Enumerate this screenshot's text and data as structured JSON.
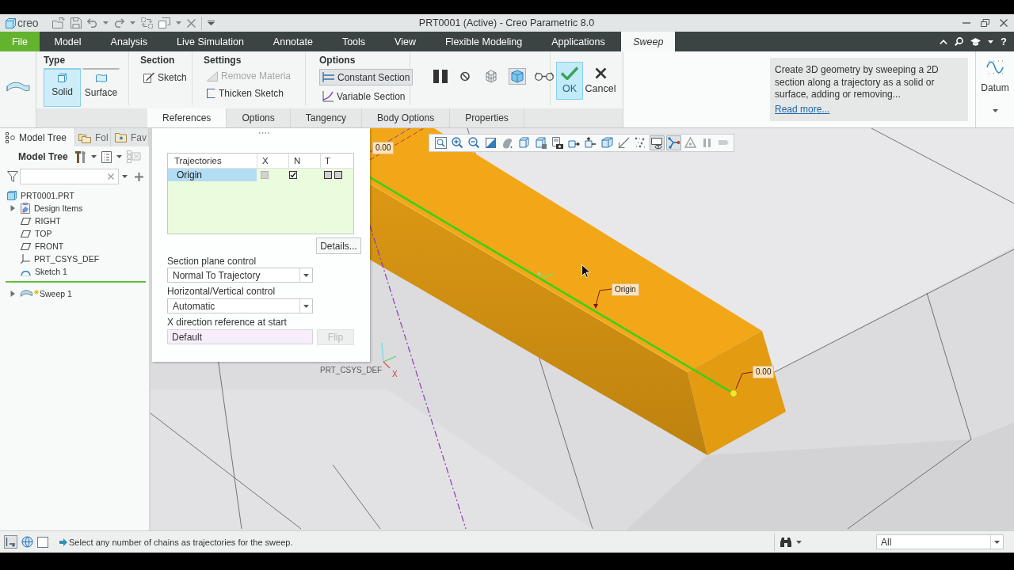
{
  "window": {
    "logo": "creo",
    "title": "PRT0001 (Active) - Creo Parametric 8.0"
  },
  "menu_tabs": [
    {
      "label": "File",
      "kind": "file",
      "selected": false
    },
    {
      "label": "Model",
      "kind": "tab",
      "selected": false
    },
    {
      "label": "Analysis",
      "kind": "tab",
      "selected": false
    },
    {
      "label": "Live Simulation",
      "kind": "tab",
      "selected": false
    },
    {
      "label": "Annotate",
      "kind": "tab",
      "selected": false
    },
    {
      "label": "Tools",
      "kind": "tab",
      "selected": false
    },
    {
      "label": "View",
      "kind": "tab",
      "selected": false
    },
    {
      "label": "Flexible Modeling",
      "kind": "tab",
      "selected": false
    },
    {
      "label": "Applications",
      "kind": "tab",
      "selected": false
    },
    {
      "label": "Sweep",
      "kind": "tab",
      "selected": true
    }
  ],
  "help_button": "?",
  "ribbon": {
    "type_group": {
      "title": "Type",
      "options": [
        {
          "label": "Solid",
          "kind": "solid",
          "selected": true
        },
        {
          "label": "Surface",
          "kind": "surface",
          "selected": false
        }
      ]
    },
    "section_group": {
      "title": "Section",
      "button": "Sketch"
    },
    "settings_group": {
      "title": "Settings",
      "items": [
        {
          "label": "Remove Materia",
          "kind": "remove",
          "disabled": true
        },
        {
          "label": "Thicken Sketch",
          "kind": "thicken",
          "disabled": false
        }
      ]
    },
    "options_group": {
      "title": "Options",
      "items": [
        {
          "label": "Constant Section",
          "kind": "constant",
          "selected": true
        },
        {
          "label": "Variable Section",
          "kind": "variable",
          "selected": false
        }
      ]
    },
    "preview_modes": [
      {
        "kind": "none",
        "selected": false
      },
      {
        "kind": "mesh",
        "selected": false
      },
      {
        "kind": "geometry",
        "selected": true
      }
    ],
    "ok_button": "OK",
    "cancel_button": "Cancel",
    "help": {
      "text": "Create 3D geometry by sweeping a 2D section along a trajectory as a solid or surface, adding or removing...",
      "link": "Read more..."
    },
    "datum_button": "Datum",
    "tabs": [
      {
        "label": "References",
        "selected": true
      },
      {
        "label": "Options",
        "selected": false
      },
      {
        "label": "Tangency",
        "selected": false
      },
      {
        "label": "Body Options",
        "selected": false
      },
      {
        "label": "Properties",
        "selected": false
      }
    ]
  },
  "model_tree": {
    "tabs": [
      {
        "label": "Model Tree",
        "kind": "tree",
        "selected": true
      },
      {
        "label": "Fol",
        "kind": "folder",
        "selected": false
      },
      {
        "label": "Fav",
        "kind": "favorites",
        "selected": false
      }
    ],
    "title": "Model Tree",
    "root": {
      "label": "PRT0001.PRT",
      "kind": "part",
      "children": [
        {
          "label": "Design Items",
          "kind": "design_items",
          "expanded": false
        },
        {
          "label": "RIGHT",
          "kind": "plane"
        },
        {
          "label": "TOP",
          "kind": "plane"
        },
        {
          "label": "FRONT",
          "kind": "plane"
        },
        {
          "label": "PRT_CSYS_DEF",
          "kind": "csys"
        },
        {
          "label": "Sketch 1",
          "kind": "sketch"
        }
      ]
    },
    "after_insert": [
      {
        "label": "Sweep 1",
        "kind": "sweep",
        "expanded": false,
        "new": true
      }
    ]
  },
  "references_panel": {
    "table": {
      "columns": [
        "Trajectories",
        "X",
        "N",
        "T"
      ],
      "rows": [
        {
          "name": "Origin",
          "selected": true,
          "x": {
            "checked": false,
            "disabled": true
          },
          "n": {
            "checked": true,
            "disabled": false
          },
          "t": [
            {
              "checked": false
            },
            {
              "checked": false
            }
          ]
        }
      ]
    },
    "details_button": "Details...",
    "fields": [
      {
        "label": "Section plane control",
        "kind": "dropdown",
        "value": "Normal To Trajectory"
      },
      {
        "label": "Horizontal/Vertical control",
        "kind": "dropdown",
        "value": "Automatic"
      },
      {
        "label": "X direction reference at start",
        "kind": "text",
        "value": "Default"
      }
    ],
    "flip_button": {
      "label": "Flip",
      "disabled": true
    }
  },
  "view_toolbar": [
    {
      "kind": "refit",
      "selected": false
    },
    {
      "kind": "zoom_in",
      "selected": false
    },
    {
      "kind": "zoom_out",
      "selected": false
    },
    {
      "kind": "repaint",
      "selected": false
    },
    {
      "kind": "display_style",
      "selected": false
    },
    {
      "kind": "orientation",
      "selected": false
    },
    {
      "kind": "view_normal",
      "selected": false
    },
    {
      "kind": "camera",
      "selected": false
    },
    {
      "kind": "next_view",
      "selected": false
    },
    {
      "kind": "previous_view",
      "selected": false
    },
    {
      "kind": "perspective",
      "selected": false
    },
    {
      "kind": "planes",
      "selected": false
    },
    {
      "kind": "points",
      "selected": false
    },
    {
      "kind": "display_eye",
      "selected": true
    },
    {
      "kind": "spin_center",
      "selected": true
    },
    {
      "kind": "triangle",
      "selected": false
    },
    {
      "kind": "pause",
      "selected": false
    },
    {
      "kind": "annotation",
      "selected": false
    }
  ],
  "viewport": {
    "annotations": [
      {
        "kind": "dimension",
        "text": "0.00"
      },
      {
        "kind": "label",
        "text": "Origin"
      },
      {
        "kind": "csys",
        "text": "PRT_CSYS_DEF"
      },
      {
        "kind": "axis",
        "text": "X"
      },
      {
        "kind": "dimension",
        "text": "0.00"
      }
    ]
  },
  "status_bar": {
    "message": "Select any number of chains as trajectories for the sweep.",
    "filter": "All"
  }
}
